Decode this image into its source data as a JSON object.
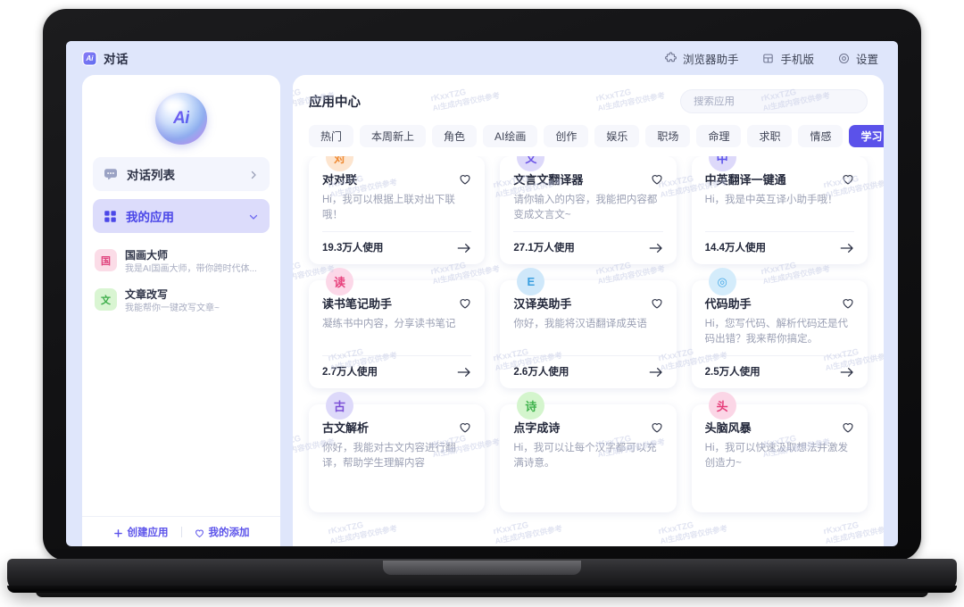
{
  "titlebar": {
    "brand_label": "对话",
    "brand_logo_text": "Ai",
    "actions": [
      {
        "label": "浏览器助手",
        "icon": "puzzle-icon"
      },
      {
        "label": "手机版",
        "icon": "mobile-icon"
      },
      {
        "label": "设置",
        "icon": "gear-icon"
      }
    ]
  },
  "sidebar": {
    "logo_text": "Ai",
    "nav": [
      {
        "label": "对话列表",
        "icon": "chat-icon",
        "chevron": "chevron-right-icon",
        "active": false
      },
      {
        "label": "我的应用",
        "icon": "grid-icon",
        "chevron": "chevron-down-icon",
        "active": true
      }
    ],
    "my_apps": [
      {
        "avatar": "国",
        "name": "国画大师",
        "desc": "我是AI国画大师，带你跨时代体..."
      },
      {
        "avatar": "文",
        "name": "文章改写",
        "desc": "我能帮你一键改写文章~"
      }
    ],
    "footer": {
      "create_label": "创建应用",
      "create_icon": "plus-icon",
      "favorites_label": "我的添加",
      "favorites_icon": "heart-icon"
    }
  },
  "main": {
    "title": "应用中心",
    "search": {
      "placeholder": "搜索应用",
      "value": ""
    },
    "tabs": [
      {
        "label": "热门",
        "active": false
      },
      {
        "label": "本周新上",
        "active": false
      },
      {
        "label": "角色",
        "active": false
      },
      {
        "label": "AI绘画",
        "active": false
      },
      {
        "label": "创作",
        "active": false
      },
      {
        "label": "娱乐",
        "active": false
      },
      {
        "label": "职场",
        "active": false
      },
      {
        "label": "命理",
        "active": false
      },
      {
        "label": "求职",
        "active": false
      },
      {
        "label": "情感",
        "active": false
      },
      {
        "label": "学习",
        "active": true
      }
    ],
    "cards": [
      {
        "badge": "对",
        "badge_color": "b-orange",
        "title": "对对联",
        "desc": "Hi，我可以根据上联对出下联哦！",
        "uses": "19.3万人使用",
        "like_icon": "heart-icon",
        "arrow_icon": "arrow-right-icon"
      },
      {
        "badge": "文",
        "badge_color": "b-purple",
        "title": "文言文翻译器",
        "desc": "请你输入的内容，我能把内容都变成文言文~",
        "uses": "27.1万人使用",
        "like_icon": "heart-icon",
        "arrow_icon": "arrow-right-icon"
      },
      {
        "badge": "中",
        "badge_color": "b-purple2",
        "title": "中英翻译一键通",
        "desc": "Hi，我是中英互译小助手哦！",
        "uses": "14.4万人使用",
        "like_icon": "heart-icon",
        "arrow_icon": "arrow-right-icon"
      },
      {
        "badge": "读",
        "badge_color": "b-pink",
        "title": "读书笔记助手",
        "desc": "凝练书中内容，分享读书笔记",
        "uses": "2.7万人使用",
        "like_icon": "heart-icon",
        "arrow_icon": "arrow-right-icon"
      },
      {
        "badge": "E",
        "badge_color": "b-blue",
        "title": "汉译英助手",
        "desc": "你好，我能将汉语翻译成英语",
        "uses": "2.6万人使用",
        "like_icon": "heart-icon",
        "arrow_icon": "arrow-right-icon"
      },
      {
        "badge": "◎",
        "badge_color": "b-blue2",
        "title": "代码助手",
        "desc": "Hi，您写代码、解析代码还是代码出错？我来帮你搞定。",
        "uses": "2.5万人使用",
        "like_icon": "heart-icon",
        "arrow_icon": "arrow-right-icon"
      },
      {
        "badge": "古",
        "badge_color": "b-lilac",
        "title": "古文解析",
        "desc": "你好，我能对古文内容进行翻译，帮助学生理解内容",
        "uses": "",
        "like_icon": "heart-icon",
        "arrow_icon": "arrow-right-icon"
      },
      {
        "badge": "诗",
        "badge_color": "b-green",
        "title": "点字成诗",
        "desc": "Hi，我可以让每个汉字都可以充满诗意。",
        "uses": "",
        "like_icon": "heart-icon",
        "arrow_icon": "arrow-right-icon"
      },
      {
        "badge": "头",
        "badge_color": "b-pink2",
        "title": "头脑风暴",
        "desc": "Hi，我可以快速汲取想法并激发创造力~",
        "uses": "",
        "like_icon": "heart-icon",
        "arrow_icon": "arrow-right-icon"
      }
    ]
  },
  "watermark": {
    "line1": "rKxxTZG",
    "line2": "AI生成内容仅供参考"
  },
  "colors": {
    "accent": "#5b52ea",
    "app_background": "#dfe6fb",
    "panel": "#ffffff"
  }
}
